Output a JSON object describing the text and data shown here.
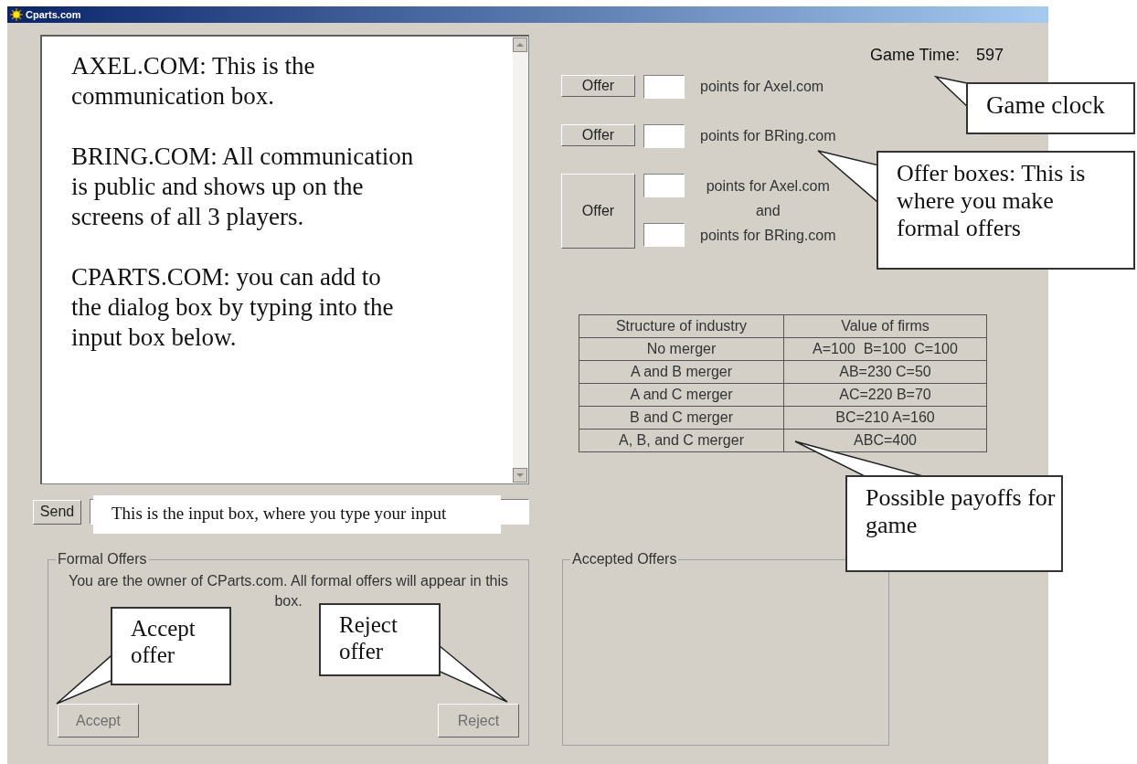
{
  "window": {
    "title": "Cparts.com"
  },
  "chat": {
    "messages": [
      "AXEL.COM: This is the communication box.",
      "BRING.COM: All communication is public and shows up on the screens of all 3 players.",
      "CPARTS.COM: you can add to the dialog box by typing into the input box below."
    ]
  },
  "send": {
    "button": "Send"
  },
  "game_time": {
    "label": "Game Time:",
    "value": "597"
  },
  "offers": [
    {
      "kind": "single",
      "button": "Offer",
      "labels": [
        "points for Axel.com"
      ]
    },
    {
      "kind": "single",
      "button": "Offer",
      "labels": [
        "points for BRing.com"
      ]
    },
    {
      "kind": "double",
      "button": "Offer",
      "labels": [
        "points for Axel.com",
        "and",
        "points for BRing.com"
      ]
    }
  ],
  "payoff_table": {
    "columns": [
      "Structure of industry",
      "Value of firms"
    ],
    "rows": [
      [
        "No merger",
        "A=100  B=100  C=100"
      ],
      [
        "A and B merger",
        "AB=230 C=50"
      ],
      [
        "A and C merger",
        "AC=220 B=70"
      ],
      [
        "B and C merger",
        "BC=210 A=160"
      ],
      [
        "A, B, and C merger",
        "ABC=400"
      ]
    ]
  },
  "formal_offers": {
    "title": "Formal Offers",
    "message": "You are the owner of CParts.com. All formal offers will appear in this box.",
    "accept": {
      "label": "Accept",
      "disabled": true
    },
    "reject": {
      "label": "Reject",
      "disabled": true
    }
  },
  "accepted_offers": {
    "title": "Accepted Offers"
  },
  "annotations": [
    {
      "kind": "callout",
      "text": "Game clock"
    },
    {
      "kind": "callout",
      "text": "Offer boxes: This is where you make formal offers"
    },
    {
      "kind": "callout",
      "text": "Possible payoffs for game"
    },
    {
      "kind": "callout",
      "text": "Accept offer"
    },
    {
      "kind": "callout",
      "text": "Reject offer"
    },
    {
      "kind": "note",
      "text": "This is the input box, where you type your input"
    }
  ]
}
